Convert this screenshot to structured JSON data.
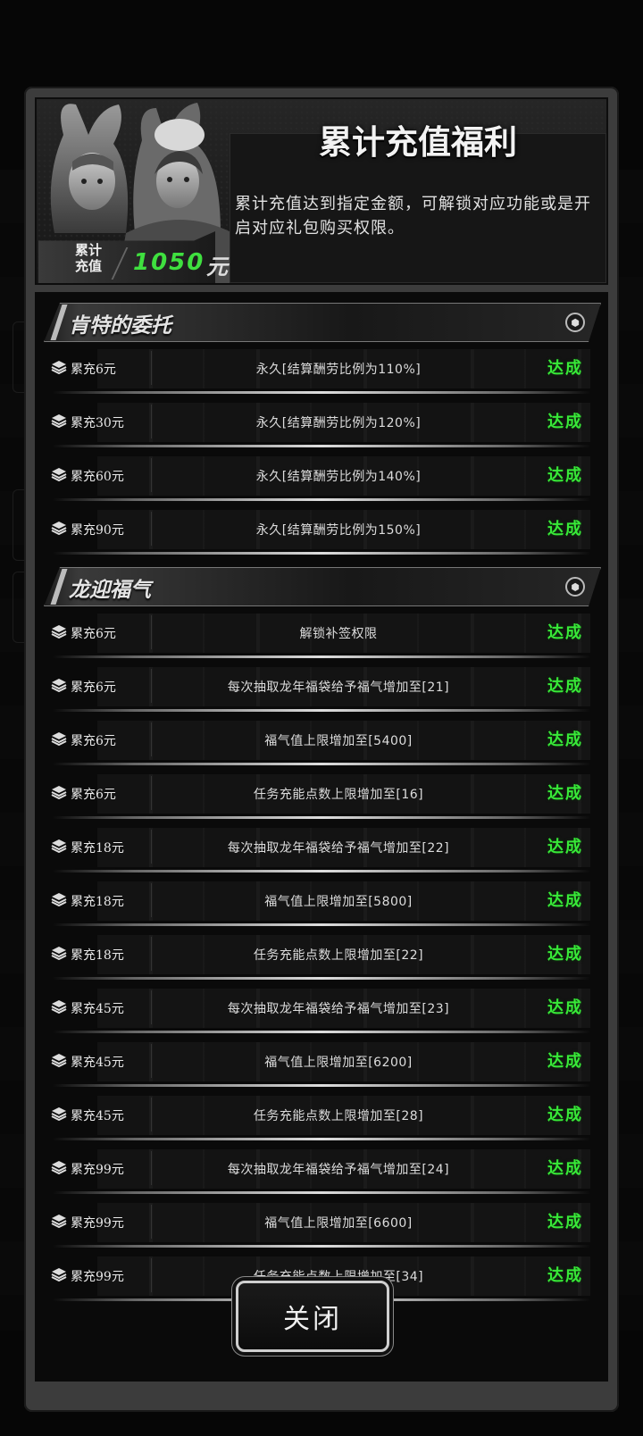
{
  "header": {
    "title": "累计充值福利",
    "description": "累计充值达到指定金额，可解锁对应功能或是开启对应礼包购买权限。",
    "recharge_label_line1": "累计",
    "recharge_label_line2": "充值",
    "recharge_amount": "1050",
    "recharge_unit": "元"
  },
  "sections": [
    {
      "title": "肯特的委托",
      "rows": [
        {
          "label": "累充6元",
          "desc": "永久[结算酬劳比例为110%]",
          "status": "达成"
        },
        {
          "label": "累充30元",
          "desc": "永久[结算酬劳比例为120%]",
          "status": "达成"
        },
        {
          "label": "累充60元",
          "desc": "永久[结算酬劳比例为140%]",
          "status": "达成"
        },
        {
          "label": "累充90元",
          "desc": "永久[结算酬劳比例为150%]",
          "status": "达成"
        }
      ]
    },
    {
      "title": "龙迎福气",
      "rows": [
        {
          "label": "累充6元",
          "desc": "解锁补签权限",
          "status": "达成"
        },
        {
          "label": "累充6元",
          "desc": "每次抽取龙年福袋给予福气增加至[21]",
          "status": "达成"
        },
        {
          "label": "累充6元",
          "desc": "福气值上限增加至[5400]",
          "status": "达成"
        },
        {
          "label": "累充6元",
          "desc": "任务充能点数上限增加至[16]",
          "status": "达成"
        },
        {
          "label": "累充18元",
          "desc": "每次抽取龙年福袋给予福气增加至[22]",
          "status": "达成"
        },
        {
          "label": "累充18元",
          "desc": "福气值上限增加至[5800]",
          "status": "达成"
        },
        {
          "label": "累充18元",
          "desc": "任务充能点数上限增加至[22]",
          "status": "达成"
        },
        {
          "label": "累充45元",
          "desc": "每次抽取龙年福袋给予福气增加至[23]",
          "status": "达成"
        },
        {
          "label": "累充45元",
          "desc": "福气值上限增加至[6200]",
          "status": "达成"
        },
        {
          "label": "累充45元",
          "desc": "任务充能点数上限增加至[28]",
          "status": "达成"
        },
        {
          "label": "累充99元",
          "desc": "每次抽取龙年福袋给予福气增加至[24]",
          "status": "达成"
        },
        {
          "label": "累充99元",
          "desc": "福气值上限增加至[6600]",
          "status": "达成"
        },
        {
          "label": "累充99元",
          "desc": "任务充能点数上限增加至[34]",
          "status": "达成"
        }
      ]
    }
  ],
  "footer": {
    "close_label": "关闭"
  },
  "colors": {
    "status_green": "#38e838",
    "amount_green": "#3fe03f"
  }
}
